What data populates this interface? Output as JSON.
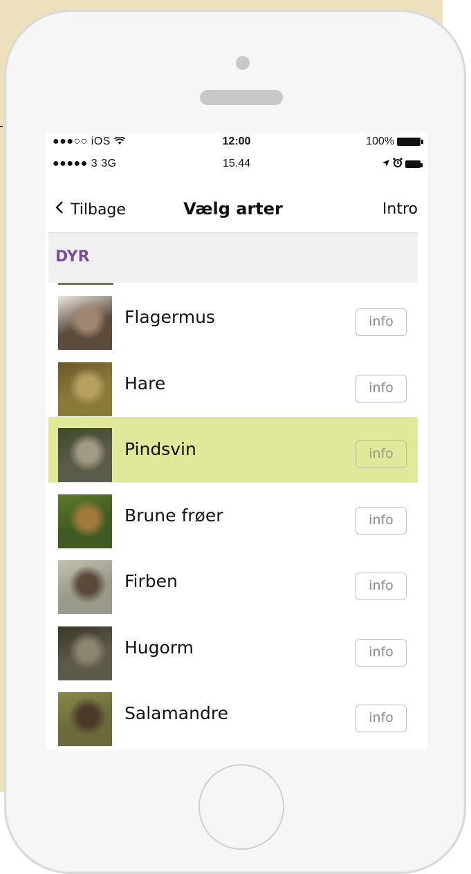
{
  "statusbar_primary": {
    "carrier": "●●●○○ iOS",
    "time": "12:00",
    "battery": "100%"
  },
  "statusbar_secondary": {
    "carrier": "●●●●● 3  3G",
    "time": "15.44"
  },
  "navbar": {
    "back_label": "Tilbage",
    "title": "Vælg arter",
    "right_label": "Intro"
  },
  "section": {
    "label": "DYR"
  },
  "species": [
    {
      "name": "Flagermus",
      "info": "info",
      "colors": [
        "#5c4a3a",
        "#a08870",
        "#e9e6df"
      ]
    },
    {
      "name": "Hare",
      "info": "info",
      "colors": [
        "#8a7a3a",
        "#b8a063",
        "#6b5a2a"
      ]
    },
    {
      "name": "Pindsvin",
      "info": "info",
      "colors": [
        "#5b5b4a",
        "#a29b84",
        "#3c4a2a"
      ],
      "selected": true
    },
    {
      "name": "Brune frøer",
      "info": "info",
      "colors": [
        "#3f5a22",
        "#a07a3a",
        "#5e7a2c"
      ]
    },
    {
      "name": "Firben",
      "info": "info",
      "colors": [
        "#9a9a8a",
        "#5a4a3a",
        "#c4c0b0"
      ]
    },
    {
      "name": "Hugorm",
      "info": "info",
      "colors": [
        "#5e5a48",
        "#8a8470",
        "#3a3628"
      ]
    },
    {
      "name": "Salamandre",
      "info": "info",
      "colors": [
        "#6a6a3a",
        "#4a3a2a",
        "#8a8a4a"
      ]
    }
  ],
  "accent_color": "#7b4f95",
  "selected_color": "#e1e89a"
}
